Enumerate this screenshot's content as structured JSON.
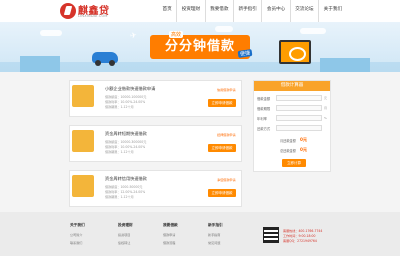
{
  "brand": {
    "name": "麒鑫贷",
    "sub": "LINXINDAI.COM"
  },
  "nav": [
    {
      "label": "首页"
    },
    {
      "label": "投资理财"
    },
    {
      "label": "我要借款"
    },
    {
      "label": "新手指引"
    },
    {
      "label": "会员中心"
    },
    {
      "label": "交流论坛"
    },
    {
      "label": "关于我们"
    }
  ],
  "banner": {
    "slogan": "分分钟借款",
    "tag_top": "高效",
    "tag_right": "便捷"
  },
  "loans": [
    {
      "title": "小额企业借款快速借款申请",
      "link": "信用借款申请",
      "lines": [
        "借款额度：10000-100000元",
        "借款利率：10.00%-24.00%",
        "借款期限：1-12个月"
      ],
      "button": "立即申请借款"
    },
    {
      "title": "资金周转短期快速借款",
      "link": "抵押借款申请",
      "lines": [
        "借款额度：10000-300000元",
        "借款利率：10.00%-24.00%",
        "借款期限：1-12个月"
      ],
      "button": "立即申请借款"
    },
    {
      "title": "资金周转信用快速借款",
      "link": "净值借款申请",
      "lines": [
        "借款额度：1000-50000元",
        "借款利率：12.00%-24.00%",
        "借款期限：1-12个月"
      ],
      "button": "立即申请借款"
    }
  ],
  "calculator": {
    "title": "借款计算器",
    "fields": [
      {
        "label": "借款金额",
        "unit": "元"
      },
      {
        "label": "借款期限",
        "unit": "月"
      },
      {
        "label": "年利率",
        "unit": "%"
      },
      {
        "label": "还款方式",
        "unit": ""
      }
    ],
    "results": [
      {
        "label": "月还款金额",
        "value": "0元"
      },
      {
        "label": "总还款金额",
        "value": "0元"
      }
    ],
    "button": "立即计算"
  },
  "footer": {
    "columns": [
      {
        "head": "关于我们",
        "links": [
          "公司简介",
          "联系我们"
        ]
      },
      {
        "head": "投资理财",
        "links": [
          "投资项目",
          "债权转让"
        ]
      },
      {
        "head": "我要借款",
        "links": [
          "借款申请",
          "借款流程"
        ]
      },
      {
        "head": "新手指引",
        "links": [
          "新手指南",
          "常见问题"
        ]
      }
    ],
    "contact": [
      "客服热线：400-1766-7744",
      "工作时间：9:00-18:00",
      "客服QQ：2721949764"
    ]
  }
}
